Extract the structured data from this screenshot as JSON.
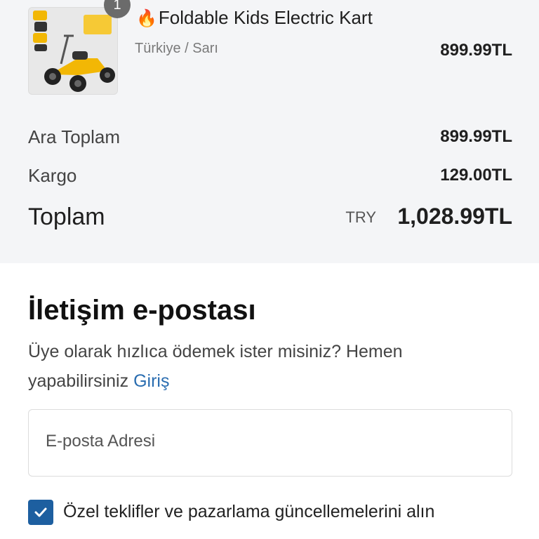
{
  "cart_item": {
    "quantity": "1",
    "fire_emoji": "🔥",
    "title": "Foldable Kids Electric Kart",
    "variant": "Türkiye / Sarı",
    "price": "899.99TL"
  },
  "summary": {
    "subtotal_label": "Ara Toplam",
    "subtotal_value": "899.99TL",
    "shipping_label": "Kargo",
    "shipping_value": "129.00TL",
    "total_label": "Toplam",
    "currency": "TRY",
    "total_value": "1,028.99TL"
  },
  "contact": {
    "title": "İletişim e-postası",
    "login_prompt": "Üye olarak hızlıca ödemek ister misiniz? Hemen yapabilirsiniz",
    "login_link": "Giriş",
    "email_placeholder": "E-posta Adresi",
    "marketing_label": "Özel teklifler ve pazarlama güncellemelerini alın",
    "marketing_checked": true
  },
  "colors": {
    "summary_bg": "#f4f5f7",
    "link": "#2a6db0",
    "checkbox": "#1d5fa0"
  }
}
